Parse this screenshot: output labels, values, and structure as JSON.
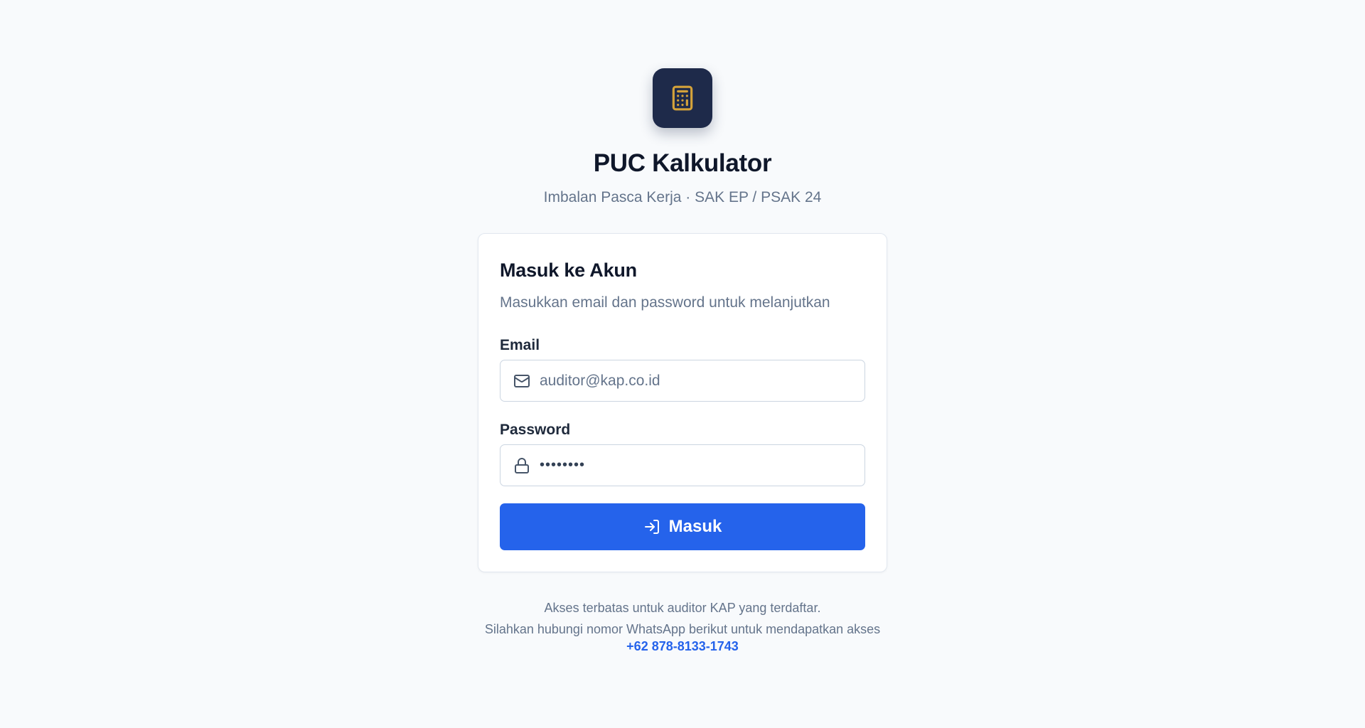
{
  "app": {
    "title": "PUC Kalkulator",
    "subtitle": "Imbalan Pasca Kerja · SAK EP / PSAK 24",
    "logo_icon": "calculator-icon"
  },
  "login": {
    "title": "Masuk ke Akun",
    "description": "Masukkan email dan password untuk melanjutkan",
    "email": {
      "label": "Email",
      "placeholder": "auditor@kap.co.id",
      "value": "",
      "icon": "mail-icon"
    },
    "password": {
      "label": "Password",
      "placeholder": "",
      "value": "••••••••",
      "icon": "lock-icon"
    },
    "submit": {
      "label": "Masuk",
      "icon": "log-in-icon"
    }
  },
  "footer": {
    "line1": "Akses terbatas untuk auditor KAP yang terdaftar.",
    "line2": "Silahkan hubungi nomor WhatsApp berikut untuk mendapatkan akses",
    "phone": "+62 878-8133-1743"
  },
  "colors": {
    "background": "#f8fafc",
    "logo_bg": "#1e2a4a",
    "logo_icon": "#d4a23a",
    "primary": "#2563eb",
    "muted_text": "#64748b"
  }
}
